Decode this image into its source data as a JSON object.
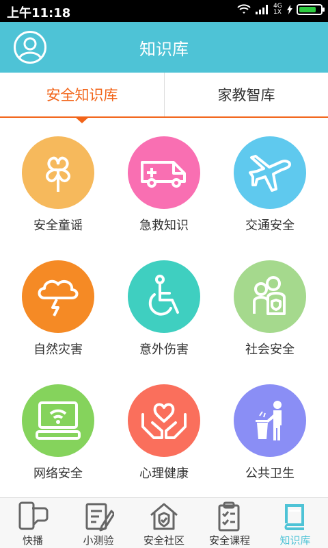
{
  "status_bar": {
    "time": "上午11:18",
    "network": "4G 1X",
    "battery_level": 0.8
  },
  "header": {
    "title": "知识库",
    "avatar_icon": "user-avatar-icon"
  },
  "tabs": [
    {
      "label": "安全知识库",
      "active": true
    },
    {
      "label": "家教智库",
      "active": false
    }
  ],
  "categories": [
    {
      "label": "安全童谣",
      "icon": "clover-icon",
      "color": "#f6b95c"
    },
    {
      "label": "急救知识",
      "icon": "ambulance-icon",
      "color": "#f96fb2"
    },
    {
      "label": "交通安全",
      "icon": "airplane-icon",
      "color": "#5fc9ee"
    },
    {
      "label": "自然灾害",
      "icon": "storm-cloud-icon",
      "color": "#f58a25"
    },
    {
      "label": "意外伤害",
      "icon": "wheelchair-icon",
      "color": "#3fcfc0"
    },
    {
      "label": "社会安全",
      "icon": "family-shield-icon",
      "color": "#a5d98d"
    },
    {
      "label": "网络安全",
      "icon": "wifi-monitor-icon",
      "color": "#85d35c"
    },
    {
      "label": "心理健康",
      "icon": "heart-hands-icon",
      "color": "#fa6f5c"
    },
    {
      "label": "公共卫生",
      "icon": "trash-person-icon",
      "color": "#8a8ef5"
    }
  ],
  "bottom_nav": [
    {
      "label": "快播",
      "icon": "phone-chat-icon",
      "active": false
    },
    {
      "label": "小测验",
      "icon": "quiz-edit-icon",
      "active": false
    },
    {
      "label": "安全社区",
      "icon": "house-shield-icon",
      "active": false
    },
    {
      "label": "安全课程",
      "icon": "clipboard-check-icon",
      "active": false
    },
    {
      "label": "知识库",
      "icon": "book-icon",
      "active": true
    }
  ],
  "colors": {
    "accent": "#4ec3d6",
    "tab_active": "#f26419"
  }
}
